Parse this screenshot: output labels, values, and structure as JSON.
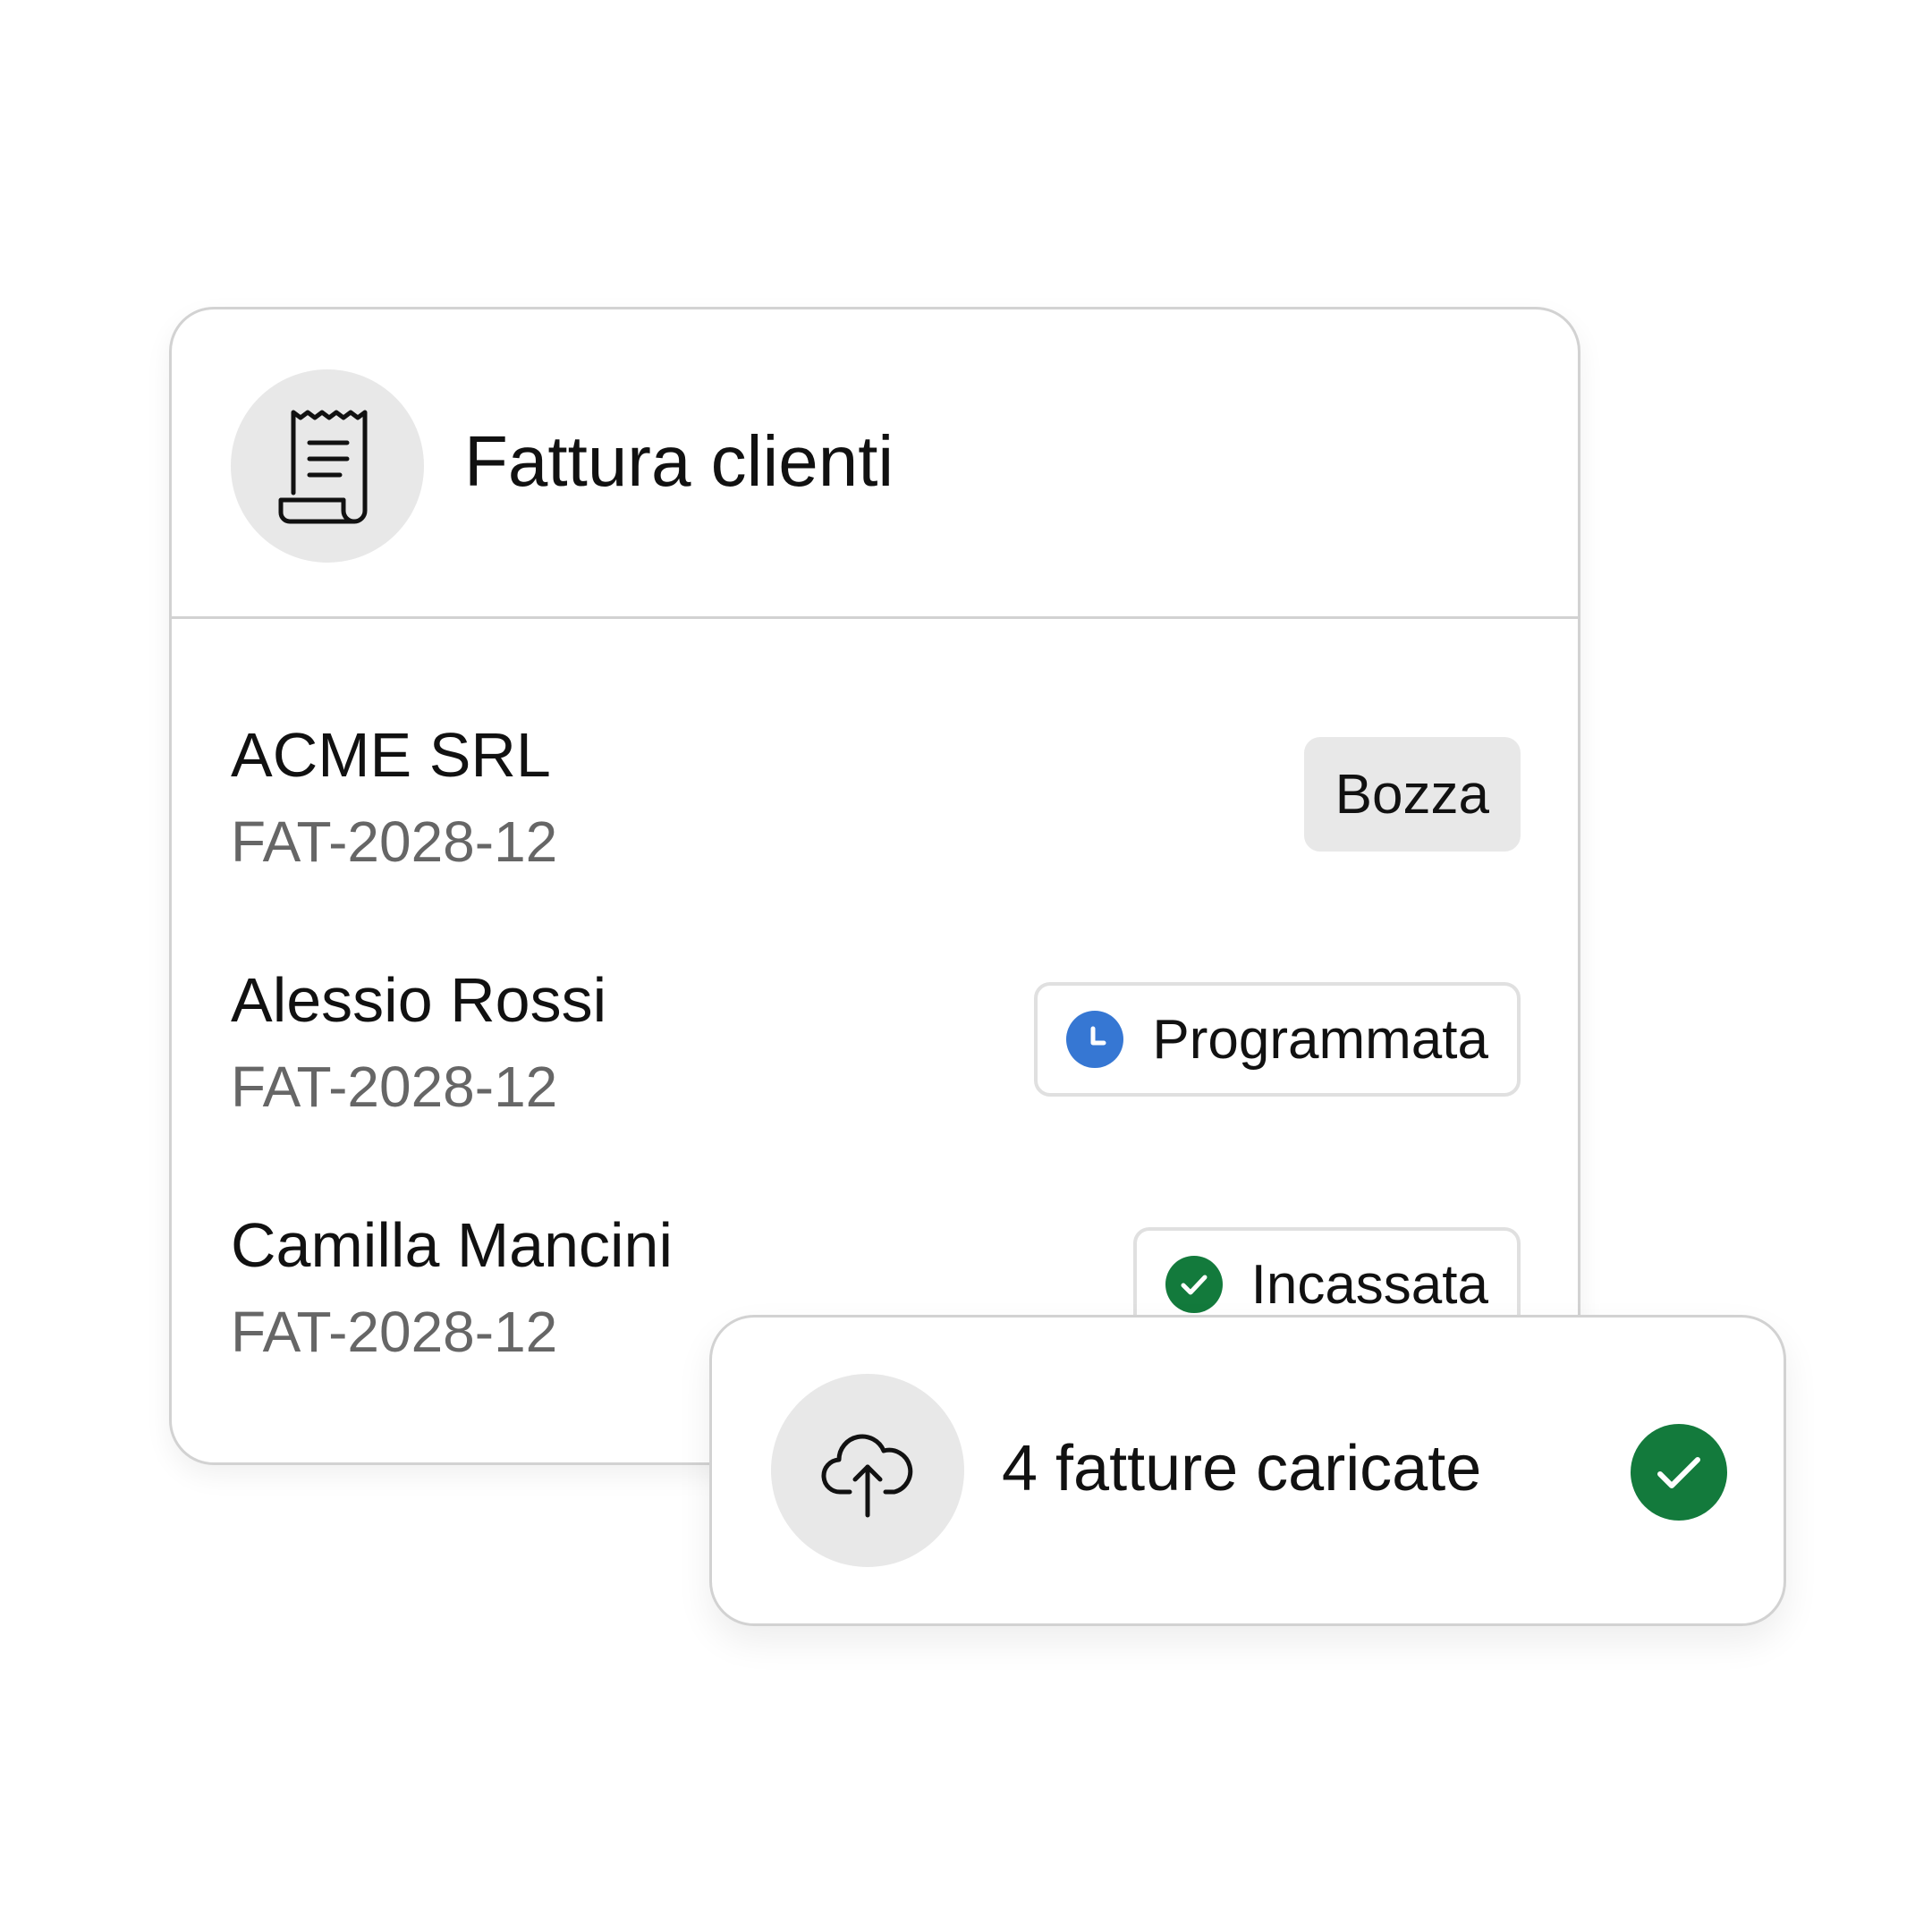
{
  "card": {
    "title": "Fattura clienti",
    "header_icon": "receipt-icon",
    "invoices": [
      {
        "name": "ACME SRL",
        "code": "FAT-2028-12",
        "status": "Bozza",
        "status_type": "draft"
      },
      {
        "name": "Alessio Rossi",
        "code": "FAT-2028-12",
        "status": "Programmata",
        "status_type": "scheduled",
        "status_icon": "clock-icon"
      },
      {
        "name": "Camilla Mancini",
        "code": "FAT-2028-12",
        "status": "Incassata",
        "status_type": "paid",
        "status_icon": "check-icon"
      }
    ]
  },
  "toast": {
    "icon": "cloud-upload-icon",
    "text": "4 fatture caricate",
    "status_icon": "check-circle-icon"
  },
  "colors": {
    "border": "#d2d2d2",
    "icon_bg": "#e8e8e8",
    "draft_bg": "#e8e8e8",
    "scheduled": "#3677d3",
    "paid": "#137a3c",
    "secondary_text": "#666666"
  }
}
